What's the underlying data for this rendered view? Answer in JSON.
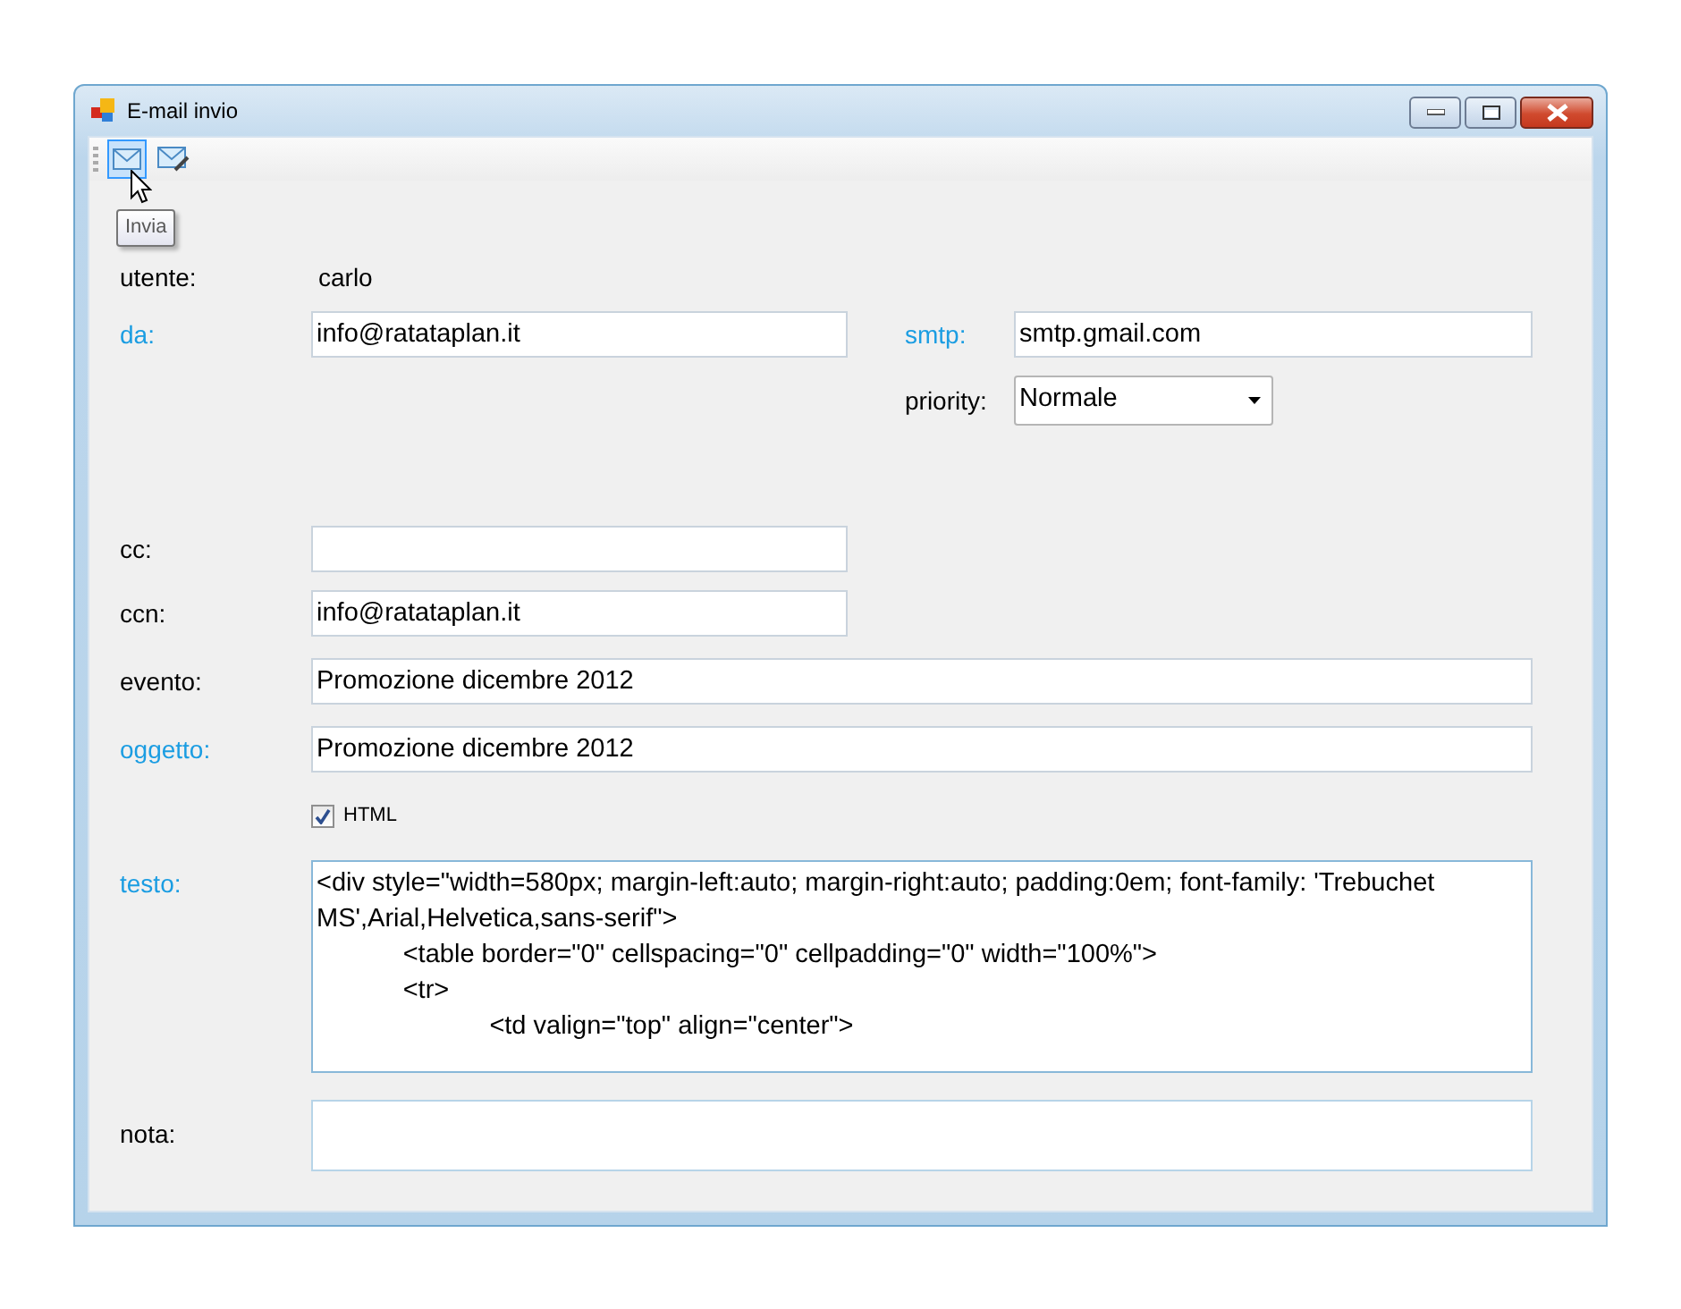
{
  "window": {
    "title": "E-mail invio"
  },
  "toolbar": {
    "buttons": [
      {
        "kind": "send",
        "selected": true
      },
      {
        "kind": "attach",
        "selected": false
      }
    ],
    "tooltip": "Invia"
  },
  "user": {
    "label": "utente:",
    "value": "carlo"
  },
  "from": {
    "label": "da:",
    "value": "info@ratataplan.it",
    "required": true
  },
  "smtp": {
    "label": "smtp:",
    "value": "smtp.gmail.com",
    "required": true
  },
  "priority": {
    "label": "priority:",
    "value": "Normale"
  },
  "fields": [
    {
      "label": "cc:",
      "kind": "short",
      "required": false
    },
    {
      "label": "ccn:",
      "kind": "short",
      "required": false,
      "value": "info@ratataplan.it"
    },
    {
      "label": "evento:",
      "kind": "wide",
      "required": false,
      "value": "Promozione dicembre 2012"
    },
    {
      "label": "oggetto:",
      "kind": "wide",
      "required": true,
      "value": "Promozione dicembre 2012"
    }
  ],
  "html_checkbox": {
    "label": "HTML",
    "checked": true
  },
  "body": {
    "label": "testo:",
    "required": true,
    "value": "<div style=\"width=580px; margin-left:auto; margin-right:auto; padding:0em; font-family: 'Trebuchet MS',Arial,Helvetica,sans-serif\">\n\t<table border=\"0\" cellspacing=\"0\" cellpadding=\"0\" width=\"100%\">\n\t<tr>\n\t\t<td valign=\"top\" align=\"center\">"
  },
  "note": {
    "label": "nota:",
    "required": false
  }
}
